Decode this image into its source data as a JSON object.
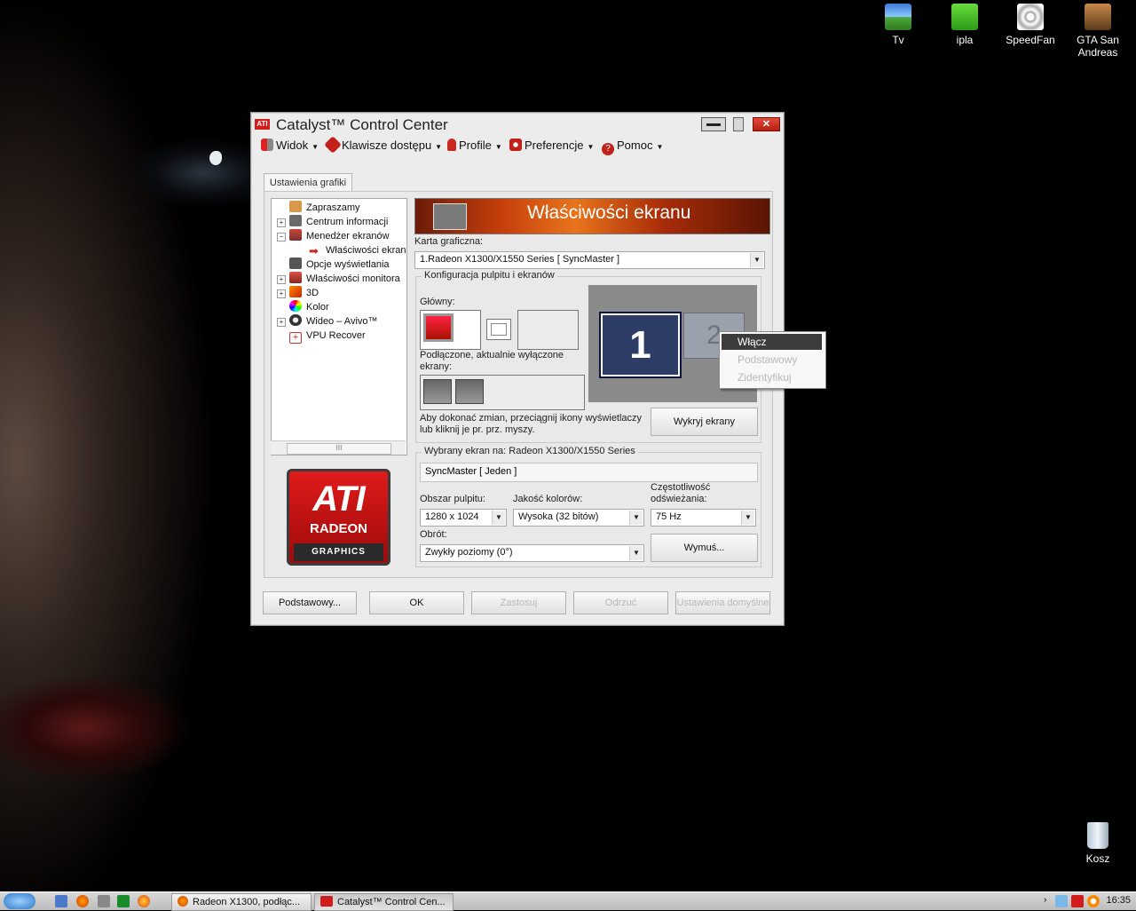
{
  "desktop": {
    "icons": [
      {
        "label": "Tv"
      },
      {
        "label": "ipla"
      },
      {
        "label": "SpeedFan"
      },
      {
        "label": "GTA San Andreas"
      },
      {
        "label": "Kosz"
      }
    ]
  },
  "window": {
    "title": "Catalyst™ Control Center",
    "logo_text": "ATI",
    "menu": [
      {
        "label": "Widok"
      },
      {
        "label": "Klawisze dostępu"
      },
      {
        "label": "Profile"
      },
      {
        "label": "Preferencje"
      },
      {
        "label": "Pomoc"
      }
    ],
    "tab": "Ustawienia grafiki",
    "tree": [
      {
        "label": "Zapraszamy"
      },
      {
        "label": "Centrum informacji",
        "expander": "+"
      },
      {
        "label": "Menedżer ekranów",
        "expander": "−"
      },
      {
        "label": "Właściwości ekranu"
      },
      {
        "label": "Opcje wyświetlania"
      },
      {
        "label": "Właściwości monitora",
        "expander": "+"
      },
      {
        "label": "3D",
        "expander": "+"
      },
      {
        "label": "Kolor"
      },
      {
        "label": "Wideo – Avivo™",
        "expander": "+"
      },
      {
        "label": "VPU Recover"
      }
    ],
    "scroll_thumb": "III",
    "ati_logo": {
      "brand": "ATI",
      "line2": "RADEON",
      "line3": "GRAPHICS"
    },
    "banner_title": "Właściwości ekranu",
    "graphics_card_label": "Karta graficzna:",
    "graphics_card_value": "1.Radeon X1300/X1550 Series  [ SyncMaster ]",
    "desktop_config": {
      "title": "Konfiguracja pulpitu i ekranów",
      "primary_label": "Główny:",
      "attached_label": "Podłączone, aktualnie wyłączone ekrany:",
      "hint": "Aby dokonać zmian, przeciągnij ikony wyświetlaczy lub kliknij je pr. prz. myszy.",
      "detect_button": "Wykryj ekrany",
      "monitor1": "1",
      "monitor2": "2"
    },
    "context_menu": [
      {
        "label": "Włącz",
        "active": true
      },
      {
        "label": "Podstawowy",
        "active": false
      },
      {
        "label": "Zidentyfikuj",
        "active": false
      }
    ],
    "selected_display": {
      "title": "Wybrany ekran na: Radeon X1300/X1550 Series",
      "name": "SyncMaster  [ Jeden ]",
      "resolution_label": "Obszar pulpitu:",
      "resolution_value": "1280 x 1024",
      "color_label": "Jakość kolorów:",
      "color_value": "Wysoka (32 bitów)",
      "refresh_label": "Częstotliwość odświeżania:",
      "refresh_value": "75 Hz",
      "rotation_label": "Obrót:",
      "rotation_value": "Zwykły poziomy (0°)",
      "force_button": "Wymuś..."
    },
    "buttons": {
      "basic": "Podstawowy...",
      "ok": "OK",
      "apply": "Zastosuj",
      "discard": "Odrzuć",
      "defaults": "Ustawienia domyślne"
    }
  },
  "taskbar": {
    "tasks": [
      {
        "label": "Radeon X1300, podłąc..."
      },
      {
        "label": "Catalyst™ Control Cen..."
      }
    ],
    "clock": "16:35"
  },
  "colors": {
    "accent_red": "#d21c1c",
    "selected_monitor": "#2e3d66",
    "menu_highlight": "#3c3c3c"
  }
}
